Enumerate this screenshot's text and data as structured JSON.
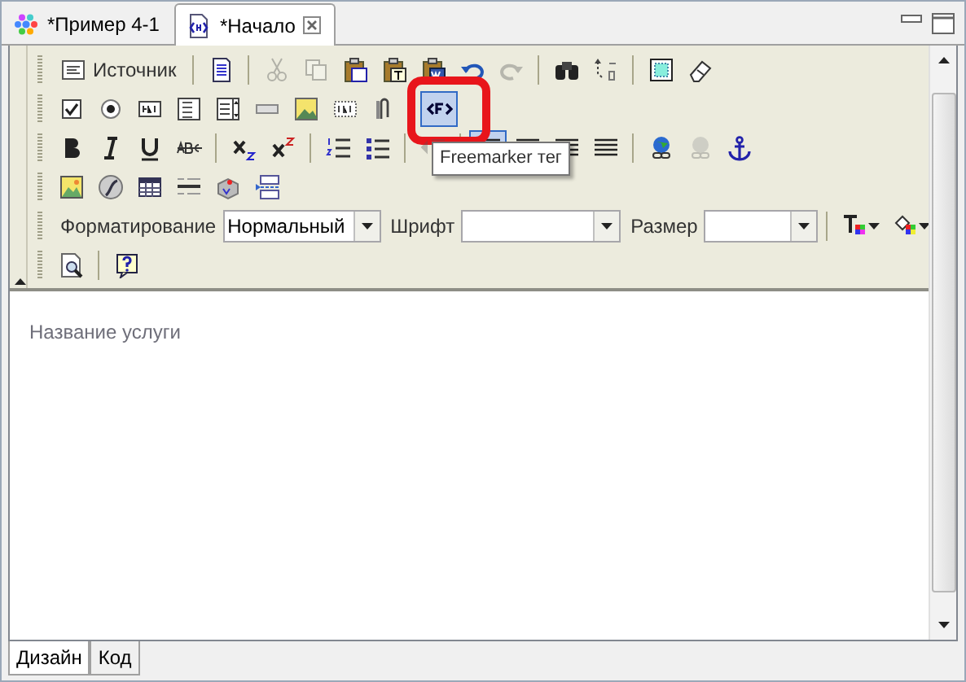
{
  "tabs": [
    {
      "label": "*Пример 4-1",
      "selected": false
    },
    {
      "label": "*Начало",
      "selected": true,
      "closable": true
    }
  ],
  "toolbar": {
    "rows": [
      {
        "items": [
          {
            "kind": "source",
            "label": "Источник"
          },
          {
            "kind": "sep"
          },
          {
            "kind": "doc"
          },
          {
            "kind": "sep"
          },
          {
            "kind": "cut",
            "disabled": true
          },
          {
            "kind": "copy",
            "disabled": true
          },
          {
            "kind": "paste"
          },
          {
            "kind": "pastetext"
          },
          {
            "kind": "pasteword"
          },
          {
            "kind": "undo"
          },
          {
            "kind": "redo",
            "disabled": true
          },
          {
            "kind": "sep"
          },
          {
            "kind": "find"
          },
          {
            "kind": "replace"
          },
          {
            "kind": "sep"
          },
          {
            "kind": "selectall"
          },
          {
            "kind": "eraser"
          }
        ]
      },
      {
        "items": [
          {
            "kind": "checkbox"
          },
          {
            "kind": "radio"
          },
          {
            "kind": "textfield"
          },
          {
            "kind": "textarea"
          },
          {
            "kind": "select"
          },
          {
            "kind": "button"
          },
          {
            "kind": "imagebutton"
          },
          {
            "kind": "hidden"
          },
          {
            "kind": "clip"
          },
          {
            "kind": "sep"
          },
          {
            "kind": "freemarker",
            "selected": true,
            "highlighted": true
          }
        ]
      },
      {
        "items": [
          {
            "kind": "bold"
          },
          {
            "kind": "italic"
          },
          {
            "kind": "underline"
          },
          {
            "kind": "strike"
          },
          {
            "kind": "sep"
          },
          {
            "kind": "sub"
          },
          {
            "kind": "sup"
          },
          {
            "kind": "sep"
          },
          {
            "kind": "ol"
          },
          {
            "kind": "ul"
          },
          {
            "kind": "sep"
          },
          {
            "kind": "outdent",
            "disabled": true
          },
          {
            "kind": "sep"
          },
          {
            "kind": "left",
            "selected": true
          },
          {
            "kind": "center"
          },
          {
            "kind": "right"
          },
          {
            "kind": "justify"
          },
          {
            "kind": "sep"
          },
          {
            "kind": "link"
          },
          {
            "kind": "unlink",
            "disabled": true
          },
          {
            "kind": "anchor"
          }
        ]
      },
      {
        "items": [
          {
            "kind": "image"
          },
          {
            "kind": "flash"
          },
          {
            "kind": "table"
          },
          {
            "kind": "hr"
          },
          {
            "kind": "smiley"
          },
          {
            "kind": "pagebreak"
          }
        ]
      },
      {
        "items": [
          {
            "kind": "combo",
            "label": "Форматирование",
            "value": "Нормальный"
          },
          {
            "kind": "combo",
            "label": "Шрифт"
          },
          {
            "kind": "combo",
            "label": "Размер"
          },
          {
            "kind": "sep"
          },
          {
            "kind": "textcolor"
          },
          {
            "kind": "bgcolor"
          }
        ]
      },
      {
        "items": [
          {
            "kind": "preview"
          },
          {
            "kind": "sep"
          },
          {
            "kind": "help"
          }
        ]
      }
    ]
  },
  "tooltip": "Freemarker тег",
  "content": "Название услуги",
  "bottom_tabs": [
    {
      "label": "Дизайн",
      "selected": true
    },
    {
      "label": "Код",
      "selected": false
    }
  ]
}
